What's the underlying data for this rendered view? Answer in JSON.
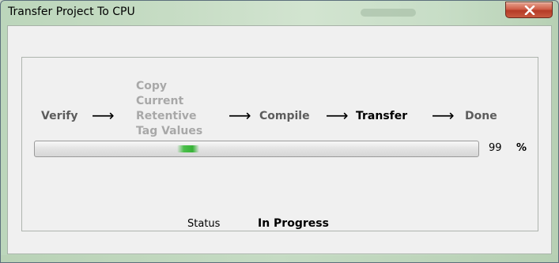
{
  "window": {
    "title": "Transfer Project To CPU"
  },
  "steps": [
    {
      "label": "Verify",
      "state": "complete"
    },
    {
      "label": "Copy\nCurrent\nRetentive\nTag Values",
      "state": "skipped"
    },
    {
      "label": "Compile",
      "state": "complete"
    },
    {
      "label": "Transfer",
      "state": "active"
    },
    {
      "label": "Done",
      "state": "pending"
    }
  ],
  "arrow_glyph": "⟶",
  "progress": {
    "value": "99",
    "unit": "%",
    "fraction": 0.99,
    "style": "marquee",
    "accent_color": "#3cb83c"
  },
  "status": {
    "label": "Status",
    "value": "In Progress"
  },
  "icons": {
    "close": "close-icon"
  }
}
